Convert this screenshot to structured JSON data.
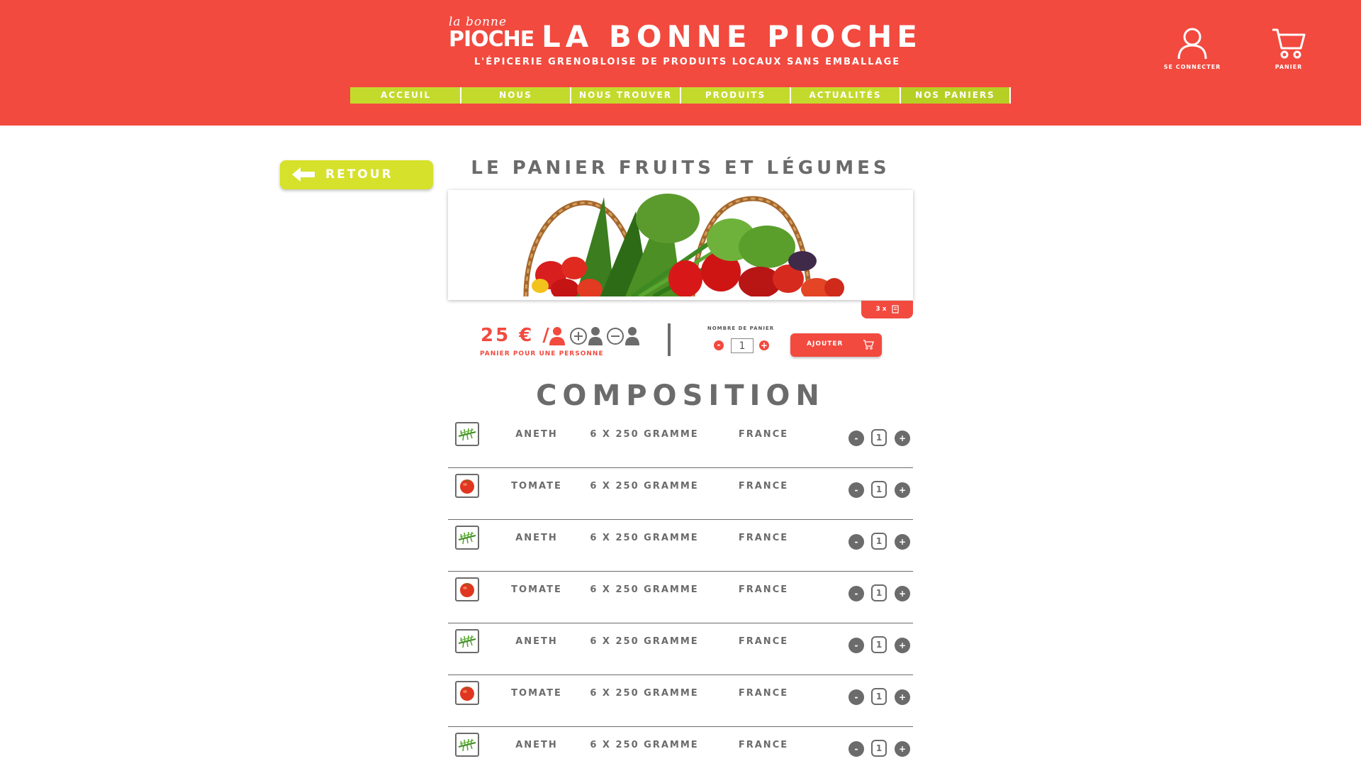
{
  "header": {
    "logo_small": "la bonne",
    "logo_big": "PIOCHE",
    "title": "LA BONNE PIOCHE",
    "tagline": "L'ÉPICERIE GRENOBLOISE DE PRODUITS LOCAUX SANS EMBALLAGE",
    "login_label": "SE CONNECTER",
    "cart_label": "PANIER",
    "bg_color": "#f24a3f"
  },
  "nav": {
    "items": [
      {
        "label": "ACCEUIL"
      },
      {
        "label": "NOUS"
      },
      {
        "label": "NOUS TROUVER"
      },
      {
        "label": "PRODUITS"
      },
      {
        "label": "ACTUALITÉS"
      },
      {
        "label": "NOS PANIERS"
      }
    ],
    "color": "#c3da2c"
  },
  "back_button": {
    "label": "RETOUR",
    "icon": "arrow-left-icon"
  },
  "product": {
    "title": "LE PANIER FRUITS ET LÉGUMES",
    "quantity_tag": "3 x",
    "price": "25 €",
    "price_sep": "/",
    "price_caption": "PANIER POUR UNE PERSONNE",
    "nb_label": "NOMBRE DE PANIER",
    "nb_minus": "-",
    "nb_value": "1",
    "nb_plus": "+",
    "add_label": "AJOUTER"
  },
  "composition": {
    "title": "COMPOSITION",
    "rows": [
      {
        "name": "ANETH",
        "quantity": "6 X 250 GRAMME",
        "origin": "FRANCE",
        "count": "1",
        "minus": "-",
        "plus": "+",
        "icon": "dill-icon"
      },
      {
        "name": "TOMATE",
        "quantity": "6 X 250 GRAMME",
        "origin": "FRANCE",
        "count": "1",
        "minus": "-",
        "plus": "+",
        "icon": "tomato-icon"
      },
      {
        "name": "ANETH",
        "quantity": "6 X 250 GRAMME",
        "origin": "FRANCE",
        "count": "1",
        "minus": "-",
        "plus": "+",
        "icon": "dill-icon"
      },
      {
        "name": "TOMATE",
        "quantity": "6 X 250 GRAMME",
        "origin": "FRANCE",
        "count": "1",
        "minus": "-",
        "plus": "+",
        "icon": "tomato-icon"
      },
      {
        "name": "ANETH",
        "quantity": "6 X 250 GRAMME",
        "origin": "FRANCE",
        "count": "1",
        "minus": "-",
        "plus": "+",
        "icon": "dill-icon"
      },
      {
        "name": "TOMATE",
        "quantity": "6 X 250 GRAMME",
        "origin": "FRANCE",
        "count": "1",
        "minus": "-",
        "plus": "+",
        "icon": "tomato-icon"
      },
      {
        "name": "ANETH",
        "quantity": "6 X 250 GRAMME",
        "origin": "FRANCE",
        "count": "1",
        "minus": "-",
        "plus": "+",
        "icon": "dill-icon"
      }
    ]
  }
}
